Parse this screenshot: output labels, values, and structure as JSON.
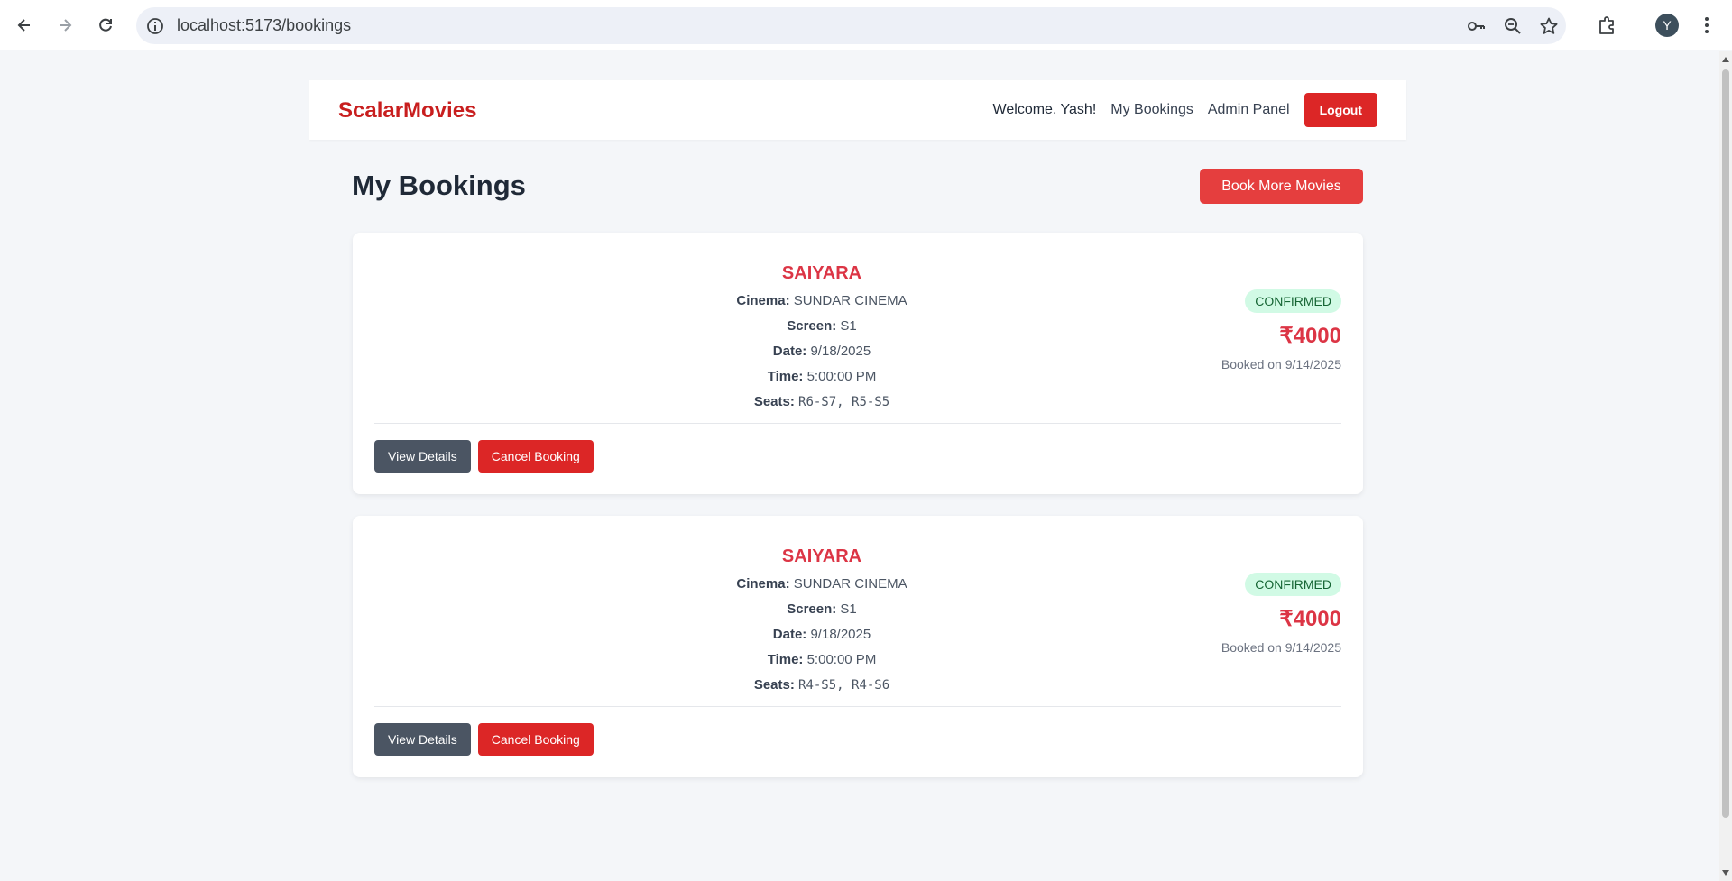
{
  "browser": {
    "url": "localhost:5173/bookings",
    "profile_initial": "Y"
  },
  "header": {
    "brand": "ScalarMovies",
    "welcome": "Welcome, Yash!",
    "nav_my_bookings": "My Bookings",
    "nav_admin_panel": "Admin Panel",
    "logout_label": "Logout"
  },
  "page": {
    "title": "My Bookings",
    "book_more_label": "Book More Movies"
  },
  "labels": {
    "cinema": "Cinema:",
    "screen": "Screen:",
    "date": "Date:",
    "time": "Time:",
    "seats": "Seats:",
    "view_details": "View Details",
    "cancel_booking": "Cancel Booking"
  },
  "bookings": [
    {
      "movie": "SAIYARA",
      "cinema": "SUNDAR CINEMA",
      "screen": "S1",
      "date": "9/18/2025",
      "time": "5:00:00 PM",
      "seats": "R6-S7, R5-S5",
      "status": "CONFIRMED",
      "price": "₹4000",
      "booked_on": "Booked on 9/14/2025"
    },
    {
      "movie": "SAIYARA",
      "cinema": "SUNDAR CINEMA",
      "screen": "S1",
      "date": "9/18/2025",
      "time": "5:00:00 PM",
      "seats": "R4-S5, R4-S6",
      "status": "CONFIRMED",
      "price": "₹4000",
      "booked_on": "Booked on 9/14/2025"
    }
  ],
  "colors": {
    "brand_red": "#c81e1e",
    "accent_red": "#dc3545",
    "status_green_bg": "#d1fae5",
    "status_green_text": "#166534",
    "view_btn": "#4b5563"
  },
  "icons": [
    "back-arrow-icon",
    "forward-arrow-icon",
    "reload-icon",
    "site-info-icon",
    "key-icon",
    "zoom-icon",
    "star-icon",
    "extensions-icon",
    "more-vert-icon"
  ]
}
